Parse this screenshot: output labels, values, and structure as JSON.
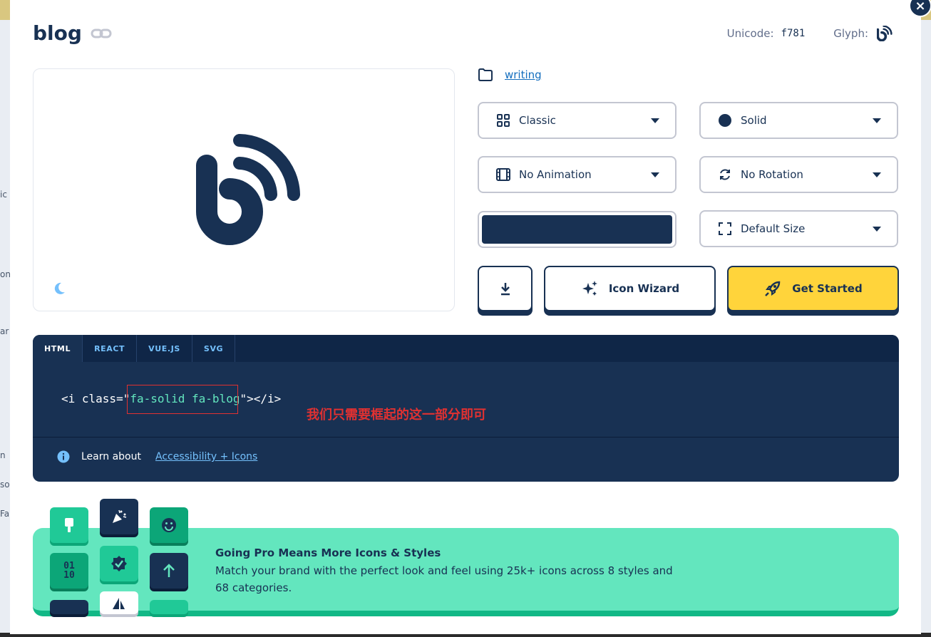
{
  "background": {
    "left_snippets": [
      "ic",
      "on",
      "ar",
      "n",
      "so",
      "Fa"
    ]
  },
  "modal": {
    "title": "blog",
    "unicode_label": "Unicode:",
    "unicode_value": "f781",
    "glyph_label": "Glyph:",
    "category_link": "writing"
  },
  "controls": {
    "family": "Classic",
    "style": "Solid",
    "animation": "No Animation",
    "rotation": "No Rotation",
    "size": "Default Size",
    "color": "#183153"
  },
  "buttons": {
    "wizard": "Icon Wizard",
    "get_started": "Get Started"
  },
  "code": {
    "tabs": [
      "HTML",
      "REACT",
      "VUE.JS",
      "SVG"
    ],
    "active_tab": "HTML",
    "snippet_prefix": "<i class=\"",
    "snippet_classes": "fa-solid fa-blog",
    "snippet_suffix": "\"></i>",
    "annotation": "我们只需要框起的这一部分即可",
    "learn_about": "Learn about",
    "learn_link": "Accessibility + Icons"
  },
  "promo": {
    "title": "Going Pro Means More Icons & Styles",
    "description": "Match your brand with the perfect look and feel using 25k+ icons across 8 styles and 68 categories.",
    "binary_text": "01\n10"
  },
  "colors": {
    "navy": "#183153",
    "yellow": "#ffd43b",
    "mint": "#63e6be",
    "link": "#146ebe"
  }
}
